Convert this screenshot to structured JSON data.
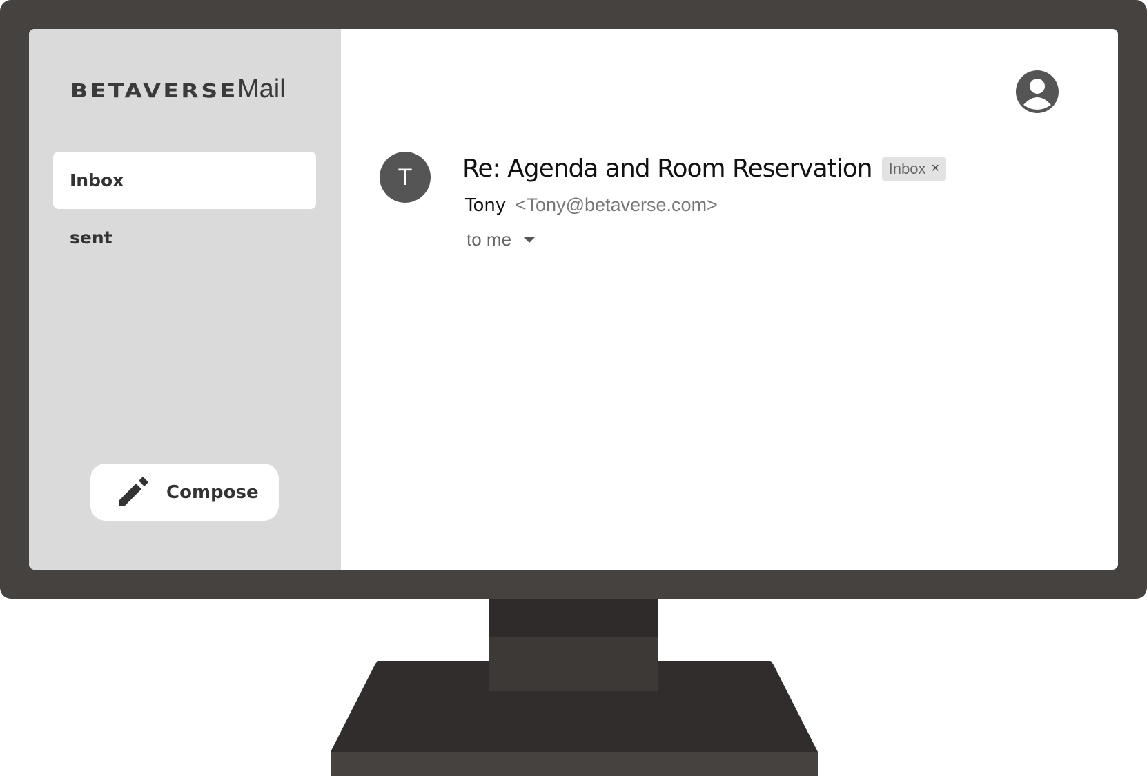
{
  "brand": {
    "logo_text": "BETAVERSE",
    "app_name": "Mail"
  },
  "sidebar": {
    "items": [
      {
        "label": "Inbox",
        "selected": true
      },
      {
        "label": "sent",
        "selected": false
      }
    ],
    "compose_label": "Compose",
    "compose_icon": "pencil-icon"
  },
  "header": {
    "account_icon": "account-circle-icon"
  },
  "email": {
    "avatar_letter": "T",
    "subject": "Re: Agenda and Room Reservation",
    "label_chip": "Inbox",
    "label_chip_close": "×",
    "from_name": "Tony",
    "from_email": "<Tony@betaverse.com>",
    "to_text": "to me"
  },
  "colors": {
    "monitor": "#454240",
    "sidebar_bg": "#dadada",
    "avatar_bg": "#555555"
  }
}
